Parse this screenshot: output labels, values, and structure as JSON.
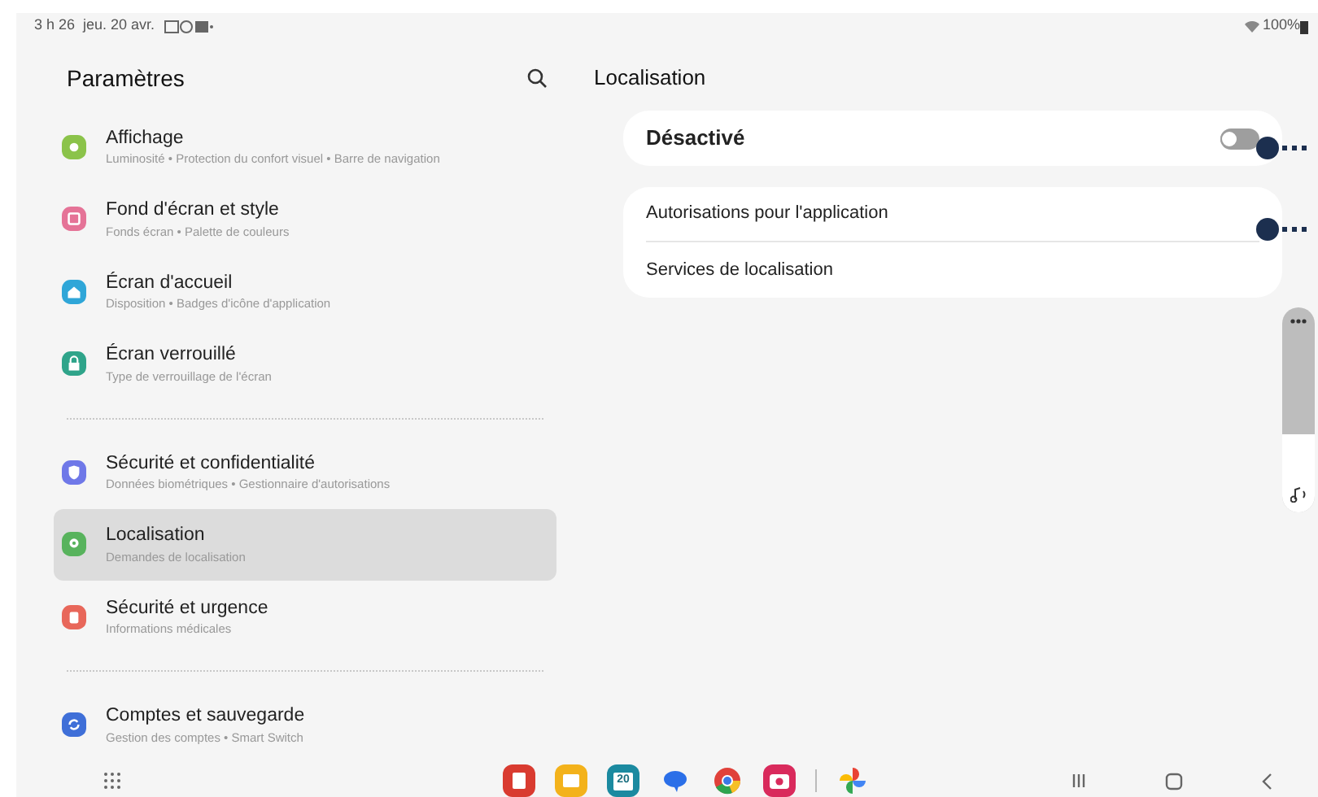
{
  "status_bar": {
    "time": "3 h 26",
    "date": "jeu. 20 avr.",
    "battery": "100%"
  },
  "sidebar": {
    "title": "Paramètres",
    "groups": [
      [
        {
          "kind": "display",
          "color": "#8bc34a",
          "title": "Affichage",
          "subtitle": "Luminosité • Protection du confort visuel • Barre de navigation",
          "selected": false
        },
        {
          "kind": "wallpaper",
          "color": "#e57397",
          "title": "Fond d'écran et style",
          "subtitle": "Fonds écran • Palette de couleurs",
          "selected": false
        },
        {
          "kind": "home",
          "color": "#2fa6d8",
          "title": "Écran d'accueil",
          "subtitle": "Disposition • Badges d'icône d'application",
          "selected": false
        },
        {
          "kind": "lock",
          "color": "#2fa48a",
          "title": "Écran verrouillé",
          "subtitle": "Type de verrouillage de l'écran",
          "selected": false
        }
      ],
      [
        {
          "kind": "shield",
          "color": "#6f78e8",
          "title": "Sécurité et confidentialité",
          "subtitle": "Données biométriques • Gestionnaire d'autorisations",
          "selected": false
        },
        {
          "kind": "pin",
          "color": "#58b35d",
          "title": "Localisation",
          "subtitle": "Demandes de localisation",
          "selected": true
        },
        {
          "kind": "alert",
          "color": "#e8675a",
          "title": "Sécurité et urgence",
          "subtitle": "Informations médicales",
          "selected": false
        }
      ],
      [
        {
          "kind": "sync",
          "color": "#3f6fd8",
          "title": "Comptes et sauvegarde",
          "subtitle": "Gestion des comptes • Smart Switch",
          "selected": false
        }
      ]
    ]
  },
  "detail": {
    "title": "Localisation",
    "master": {
      "label": "Désactivé",
      "on": false
    },
    "options": [
      "Autorisations pour l'application",
      "Services de localisation"
    ]
  },
  "volume": {
    "level": 0.38
  },
  "dock": {
    "apps": [
      {
        "kind": "notes"
      },
      {
        "kind": "files"
      },
      {
        "kind": "calendar",
        "text": "20"
      },
      {
        "kind": "messages"
      },
      {
        "kind": "browser"
      },
      {
        "kind": "camera"
      }
    ],
    "recent": [
      {
        "kind": "photos"
      }
    ]
  }
}
